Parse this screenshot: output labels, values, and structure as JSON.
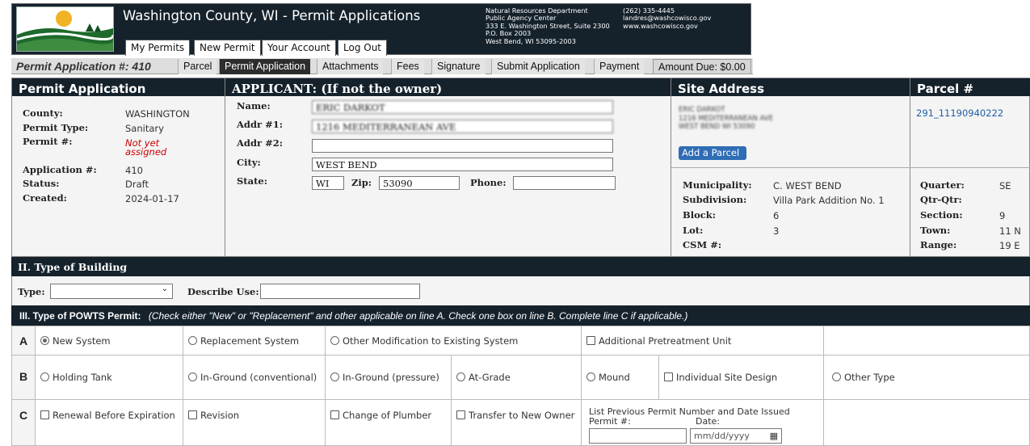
{
  "header": {
    "title": "Washington County, WI - Permit Applications",
    "nav": [
      "My Permits",
      "New Permit",
      "Your Account",
      "Log Out"
    ],
    "dept_lines": [
      "Natural Resources Department",
      "Public Agency Center",
      "333 E. Washington Street, Suite 2300",
      "P.O. Box 2003",
      "West Bend, WI 53095-2003"
    ],
    "contact_lines": [
      "(262) 335-4445",
      "landres@washcowisco.gov",
      "www.washcowisco.gov"
    ]
  },
  "tabs": {
    "app_number": "Permit Application #: 410",
    "items": [
      "Parcel",
      "Permit Application",
      "Attachments",
      "Fees",
      "Signature",
      "Submit Application",
      "Payment"
    ],
    "active": "Permit Application",
    "amount_due": "Amount Due: $0.00"
  },
  "permit_app": {
    "header": "Permit Application",
    "labels": [
      "County:",
      "Permit Type:",
      "Permit #:",
      "Application #:",
      "Status:",
      "Created:"
    ],
    "values": [
      "WASHINGTON",
      "Sanitary",
      "Not yet assigned",
      "410",
      "Draft",
      "2024-01-17"
    ]
  },
  "applicant": {
    "header": "APPLICANT: (If not the owner)",
    "labels": {
      "name": "Name:",
      "addr1": "Addr #1:",
      "addr2": "Addr #2:",
      "city": "City:",
      "state": "State:",
      "zip": "Zip:",
      "phone": "Phone:"
    },
    "values": {
      "name": "ERIC DARKOT",
      "addr1": "1216 MEDITERRANEAN AVE",
      "addr2": "",
      "city": "WEST BEND",
      "state": "WI",
      "zip": "53090",
      "phone": ""
    }
  },
  "site": {
    "header": "Site Address",
    "address_lines": [
      "ERIC DARKOT",
      "1216 MEDITERRANEAN AVE",
      "WEST BEND WI 53090"
    ],
    "add_parcel": "Add a Parcel",
    "labels": [
      "Municipality:",
      "Subdivision:",
      "Block:",
      "Lot:",
      "CSM #:"
    ],
    "values": [
      "C. WEST BEND",
      "Villa Park Addition No. 1",
      "6",
      "3",
      ""
    ]
  },
  "parcel": {
    "header": "Parcel #",
    "number": "291_11190940222",
    "labels": [
      "Quarter:",
      "Qtr-Qtr:",
      "Section:",
      "Town:",
      "Range:"
    ],
    "values": [
      "SE",
      "",
      "9",
      "11 N",
      "19 E"
    ]
  },
  "building": {
    "header": "II. Type of Building",
    "type_label": "Type:",
    "type_value": "",
    "describe_label": "Describe Use:",
    "describe_value": ""
  },
  "powts": {
    "header": "III. Type of POWTS Permit:",
    "instructions": "(Check either \"New\" or \"Replacement\" and other applicable on line A. Check one box on line B. Complete line C if applicable.)",
    "row_a": {
      "label": "A",
      "options": [
        "New System",
        "Replacement System",
        "Other Modification to Existing System",
        "Additional Pretreatment Unit"
      ]
    },
    "row_b": {
      "label": "B",
      "options": [
        "Holding Tank",
        "In-Ground (conventional)",
        "In-Ground (pressure)",
        "At-Grade",
        "Mound",
        "Individual Site Design",
        "Other Type"
      ]
    },
    "row_c": {
      "label": "C",
      "options": [
        "Renewal Before Expiration",
        "Revision",
        "Change of Plumber",
        "Transfer to New Owner"
      ],
      "prev_label": "List Previous Permit Number and Date Issued",
      "permit_label": "Permit #:",
      "date_label": "Date:",
      "date_placeholder": "mm/dd/yyyy"
    }
  },
  "colors": {
    "dark": "#15222c",
    "link": "#1f5fa6",
    "red": "#cc0000",
    "button": "#2f6db5"
  }
}
